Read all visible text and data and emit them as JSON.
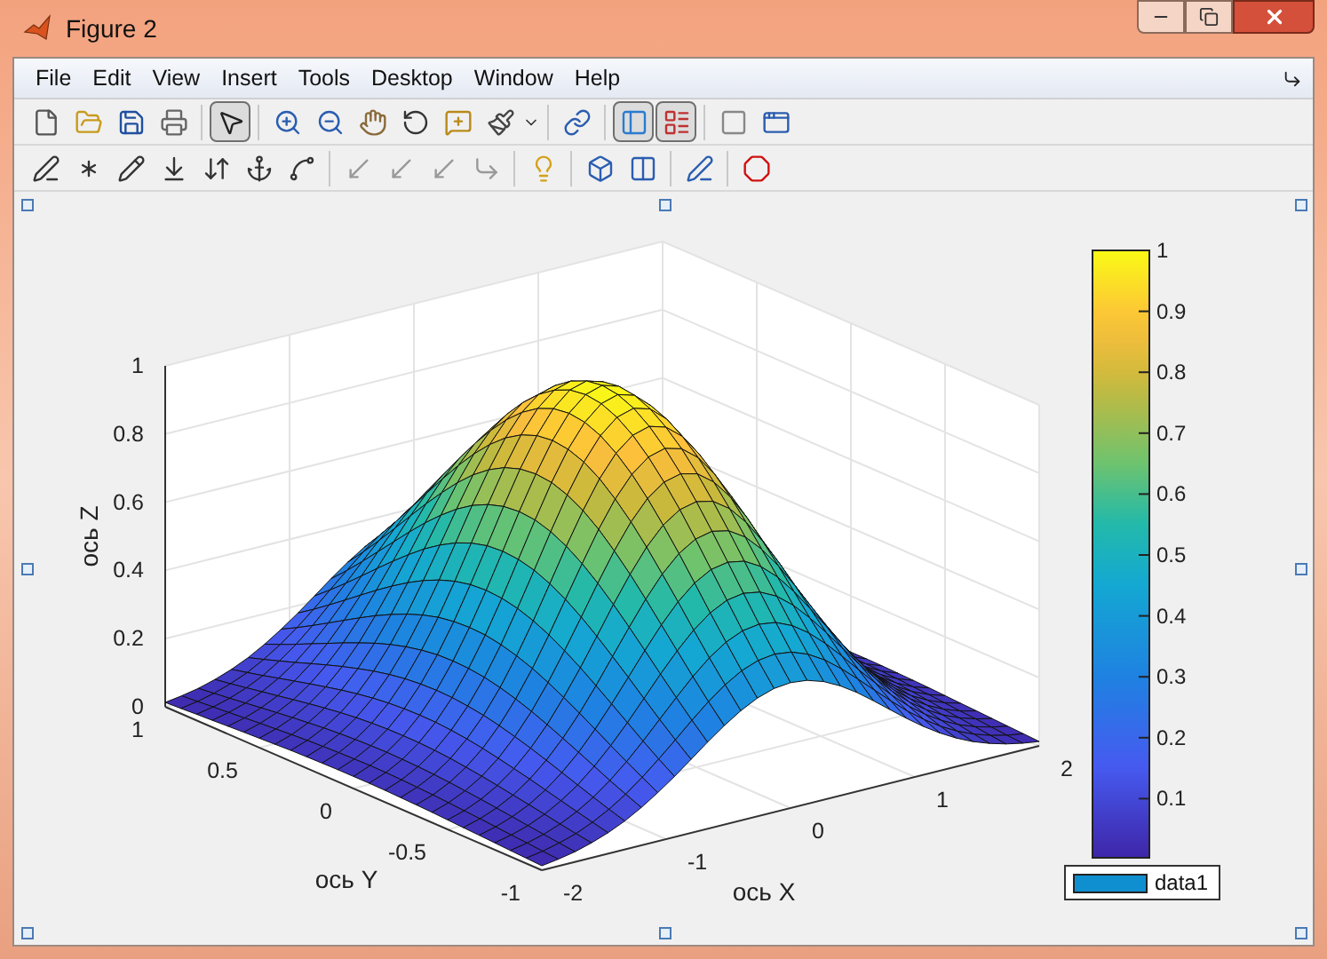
{
  "window": {
    "title": "Figure 2"
  },
  "menu": [
    "File",
    "Edit",
    "View",
    "Insert",
    "Tools",
    "Desktop",
    "Window",
    "Help"
  ],
  "toolbar_1": [
    {
      "pressed": false
    },
    {
      "pressed": false
    },
    {
      "pressed": false
    },
    {
      "pressed": false
    },
    {
      "pressed": true
    },
    {
      "pressed": false
    },
    {
      "pressed": false
    },
    {
      "pressed": false
    },
    {
      "pressed": false
    },
    {
      "pressed": false
    },
    {
      "pressed": false
    },
    {
      "pressed": false
    },
    {
      "pressed": true
    },
    {
      "pressed": true
    },
    {
      "pressed": false
    },
    {
      "pressed": false
    }
  ],
  "toolbar_2": [
    {
      "pressed": false
    },
    {
      "pressed": false
    },
    {
      "pressed": false
    },
    {
      "pressed": false
    },
    {
      "pressed": false
    },
    {
      "pressed": false
    },
    {
      "pressed": false
    },
    {
      "pressed": false
    },
    {
      "pressed": false
    },
    {
      "pressed": false
    },
    {
      "pressed": false
    },
    {
      "pressed": false
    },
    {
      "pressed": false
    },
    {
      "pressed": false
    },
    {
      "pressed": false
    },
    {
      "pressed": false
    }
  ],
  "plot": {
    "zlabel": "ось Z",
    "ylabel": "ось Y",
    "xlabel": "ось X",
    "zticks": [
      "1",
      "0.8",
      "0.6",
      "0.4",
      "0.2",
      "0"
    ],
    "yticks": [
      "1",
      "0.5",
      "0",
      "-0.5",
      "-1"
    ],
    "xticks": [
      "-2",
      "-1",
      "0",
      "1",
      "2"
    ]
  },
  "colorbar": {
    "ticks": [
      "1",
      "0.9",
      "0.8",
      "0.7",
      "0.6",
      "0.5",
      "0.4",
      "0.3",
      "0.2",
      "0.1"
    ]
  },
  "legend": {
    "label": "data1",
    "color": "#0f8fd0"
  }
}
